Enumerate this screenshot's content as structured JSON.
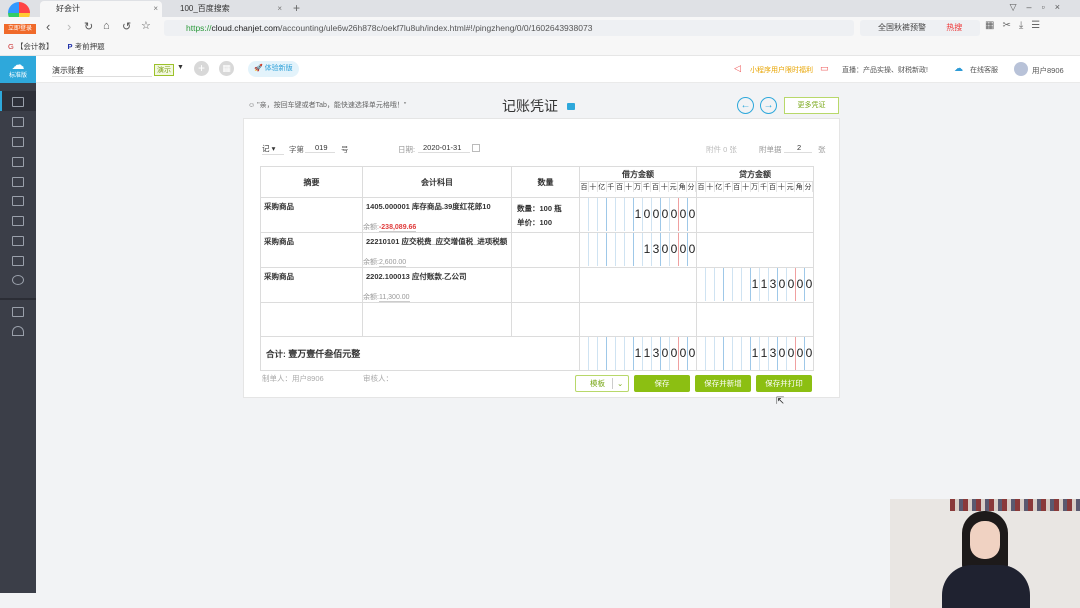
{
  "browser": {
    "tabs": [
      {
        "label": "好会计"
      },
      {
        "label": "100_百度搜索"
      }
    ],
    "url_prefix": "https://",
    "url_host": "cloud.chanjet.com",
    "url_path": "/accounting/ule6w26h878c/oekf7lu8uh/index.html#!/pingzheng/0/0/1602643938073",
    "search": "全国秋裤预警",
    "hot": "热搜",
    "badge": "立即登录",
    "bookmarks": [
      "【会计教】",
      "考前押题"
    ]
  },
  "header": {
    "logo": "标准版",
    "account": "演示账套",
    "demo_tag": "演示",
    "new_version": "体验新版",
    "promo": "小程序用户限时福利",
    "live": "直播：产品实操、财税新政!",
    "service": "在线客服",
    "user": "用户8906"
  },
  "voucher": {
    "tip": "\"亲，按回车键或者Tab，能快速选择单元格哦！\"",
    "title": "记账凭证",
    "more": "更多凭证",
    "type": "记",
    "seq_label": "字第",
    "seq": "019",
    "seq_unit": "号",
    "date_label": "日期:",
    "date": "2020-01-31",
    "attach_label": "附件 0 张",
    "docs_label": "附单据",
    "docs": "2",
    "docs_unit": "张",
    "columns": {
      "summary": "摘要",
      "account": "会计科目",
      "qty": "数量",
      "debit": "借方金额",
      "credit": "贷方金额"
    },
    "digit_units": [
      "百",
      "十",
      "亿",
      "千",
      "百",
      "十",
      "万",
      "千",
      "百",
      "十",
      "元",
      "角",
      "分"
    ],
    "rows": [
      {
        "summary": "采购商品",
        "account": "1405.000001 库存商品.39度红花郎10",
        "balance_label": "余额:",
        "balance": "-238,089.66",
        "balance_negative": true,
        "qty": "数量：100 瓶",
        "price": "单价：100",
        "debit": "1000000",
        "credit": ""
      },
      {
        "summary": "采购商品",
        "account": "22210101 应交税费_应交增值税_进项税额",
        "balance_label": "余额:",
        "balance": "2,600.00",
        "debit": "130000",
        "credit": ""
      },
      {
        "summary": "采购商品",
        "account": "2202.100013 应付账款.乙公司",
        "balance_label": "余额:",
        "balance": "11,300.00",
        "debit": "",
        "credit": "1130000"
      },
      {
        "summary": "",
        "account": "",
        "debit": "",
        "credit": ""
      }
    ],
    "total_label": "合计:",
    "total_words": "壹万壹仟叁佰元整",
    "total_debit": "1130000",
    "total_credit": "1130000",
    "maker_label": "制单人：用户8906",
    "reviewer_label": "审核人：",
    "buttons": {
      "template": "模板",
      "save": "保存",
      "save_new": "保存并新增",
      "save_print": "保存并打印"
    }
  },
  "colors": {
    "accent": "#8cbf12",
    "sidebar": "#3b3e48",
    "logo": "#2ea8db",
    "negative": "#e03c3c"
  }
}
